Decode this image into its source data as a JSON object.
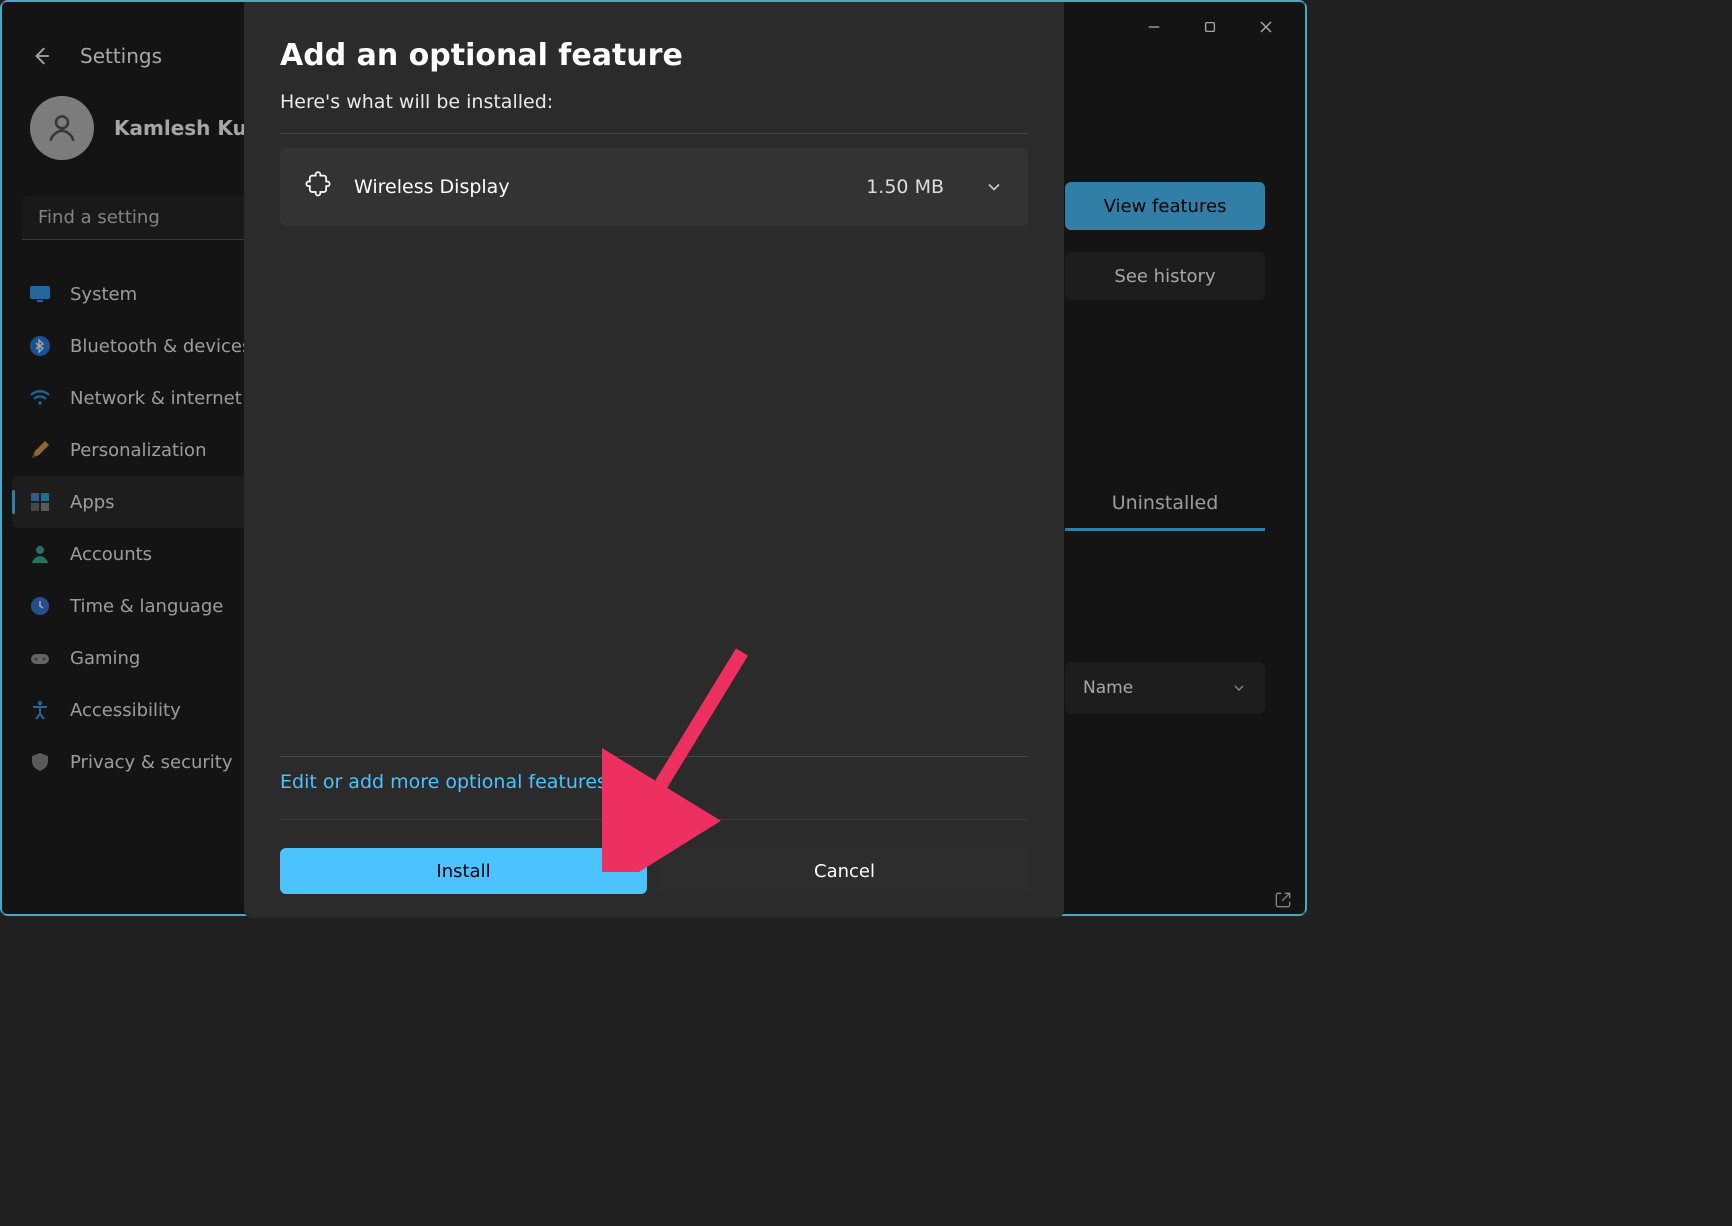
{
  "app": {
    "title": "Settings"
  },
  "profile": {
    "name": "Kamlesh Ku"
  },
  "search": {
    "placeholder": "Find a setting"
  },
  "nav": {
    "items": [
      {
        "label": "System"
      },
      {
        "label": "Bluetooth & devices"
      },
      {
        "label": "Network & internet"
      },
      {
        "label": "Personalization"
      },
      {
        "label": "Apps"
      },
      {
        "label": "Accounts"
      },
      {
        "label": "Time & language"
      },
      {
        "label": "Gaming"
      },
      {
        "label": "Accessibility"
      },
      {
        "label": "Privacy & security"
      }
    ]
  },
  "main": {
    "view_features": "View features",
    "see_history": "See history",
    "tab": "Uninstalled",
    "sort": "Name"
  },
  "dialog": {
    "title": "Add an optional feature",
    "subtitle": "Here's what will be installed:",
    "feature": {
      "name": "Wireless Display",
      "size": "1.50 MB"
    },
    "edit_link": "Edit or add more optional features",
    "install": "Install",
    "cancel": "Cancel"
  }
}
